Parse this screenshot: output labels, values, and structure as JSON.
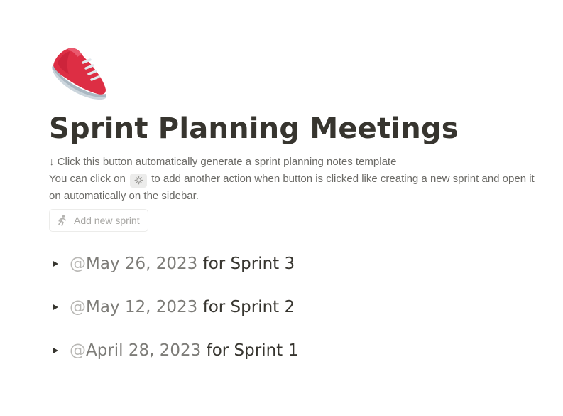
{
  "page": {
    "icon": "running-shoe-icon",
    "title": "Sprint Planning Meetings",
    "description": {
      "line1_arrow": "↓",
      "line1": "Click this button automatically generate a sprint planning notes template",
      "line2_before": "You can click on",
      "line2_icon": "gear-icon",
      "line2_after": "to add another action when button is clicked like creating a new sprint and open it on automatically on the sidebar."
    },
    "button": {
      "icon": "running-person-icon",
      "label": "Add new sprint"
    },
    "toggles": [
      {
        "at": "@",
        "date": "May 26, 2023",
        "rest": "for Sprint 3"
      },
      {
        "at": "@",
        "date": "May 12, 2023",
        "rest": "for Sprint 2"
      },
      {
        "at": "@",
        "date": "April 28, 2023",
        "rest": "for Sprint 1"
      }
    ]
  },
  "colors": {
    "text": "#37352f",
    "muted": "#6b6a66",
    "shoe_red": "#dd2e44"
  }
}
